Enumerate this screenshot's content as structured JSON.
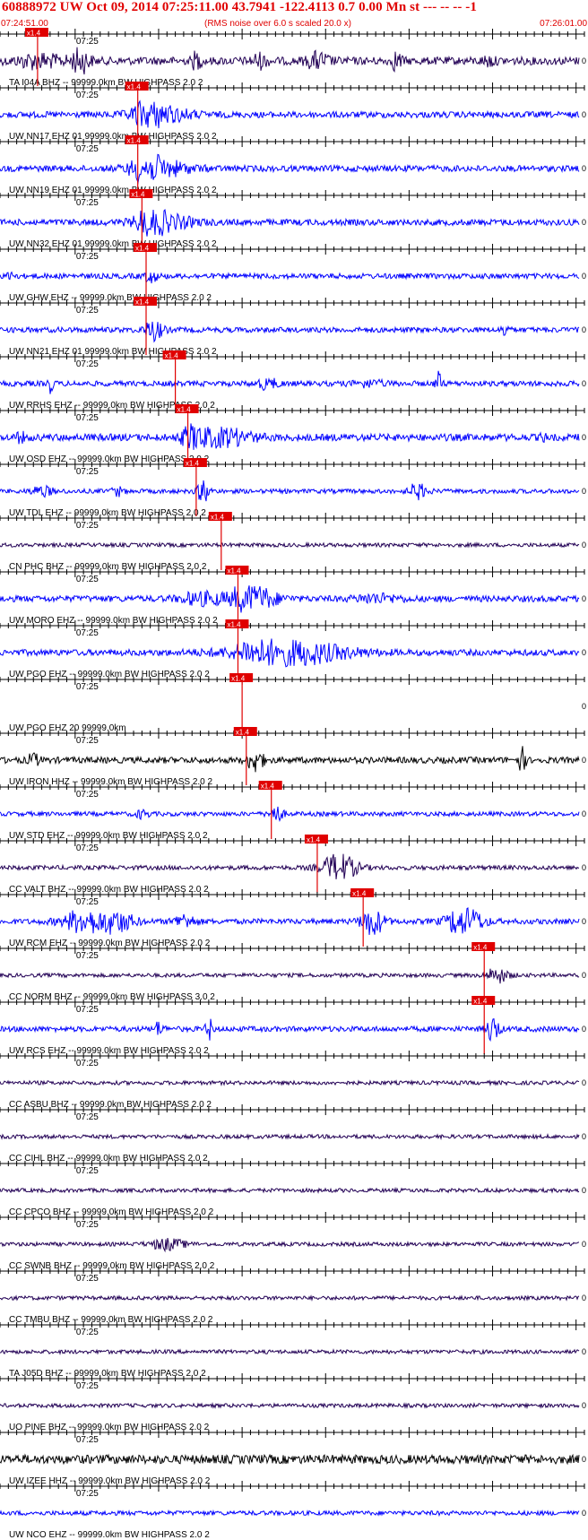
{
  "header": {
    "title": "60888972 UW Oct 09, 2014 07:25:11.00    43.7941 -122.4113  0.7 0.00 Mn st --- -- --  -1",
    "start_time": "07:24:51.00",
    "noise_note": "(RMS noise over 6.0 s scaled 20.0 x)",
    "end_time": "07:26:01.00"
  },
  "colors": {
    "red": "#e00000",
    "blue": "#0000ff",
    "navy": "#220055",
    "black": "#000000",
    "axis": "#000000"
  },
  "chart_data": {
    "type": "seismogram",
    "x_range_seconds": [
      0,
      70
    ],
    "x_start": "07:24:51.00",
    "x_end": "07:26:01.00",
    "minute_tick_label": "07:25",
    "minute_tick_seconds": 9,
    "pick_label": "x1.4",
    "traces": [
      {
        "label": "TA I04A BHZ -- 99999.0km BW  HIGHPASS  2.0  2",
        "color": "navy",
        "amp": 0.45,
        "pick_seconds": 4.5,
        "bursts": [
          [
            9.5,
            0.8,
            1.4
          ],
          [
            4.5,
            2.0,
            0.7
          ],
          [
            23.5,
            0.4,
            0.9
          ],
          [
            31,
            0.7,
            0.7
          ],
          [
            38,
            1.0,
            0.8
          ],
          [
            47.5,
            0.4,
            1.0
          ],
          [
            58.5,
            0.5,
            0.5
          ]
        ]
      },
      {
        "label": "UW NN17 EHZ 01 99999.0km BW  HIGHPASS  2.0  2",
        "color": "blue",
        "amp": 0.35,
        "pick_seconds": 16.5,
        "bursts": [
          [
            17.5,
            1.0,
            2.2
          ],
          [
            19,
            2.5,
            0.9
          ]
        ]
      },
      {
        "label": "UW NN19 EHZ 01 99999.0km BW  HIGHPASS  2.0  2",
        "color": "blue",
        "amp": 0.35,
        "pick_seconds": 16.5,
        "bursts": [
          [
            17.2,
            1.0,
            2.2
          ],
          [
            19,
            2.5,
            0.9
          ]
        ]
      },
      {
        "label": "UW NN32 EHZ 01 99999.0km BW  HIGHPASS  2.0  2",
        "color": "blue",
        "amp": 0.35,
        "pick_seconds": 17,
        "bursts": [
          [
            17.8,
            1.0,
            1.8
          ],
          [
            19.5,
            2.5,
            0.8
          ]
        ]
      },
      {
        "label": "UW GHW EHZ -- 99999.0km BW  HIGHPASS  2.0  2",
        "color": "blue",
        "amp": 0.3,
        "pick_seconds": 17.5,
        "bursts": [
          [
            1.3,
            0.3,
            0.7
          ],
          [
            18,
            0.6,
            0.6
          ]
        ]
      },
      {
        "label": "UW NN21 EHZ 01 99999.0km BW  HIGHPASS  2.0  2",
        "color": "blue",
        "amp": 0.3,
        "pick_seconds": 17.5,
        "bursts": [
          [
            18.3,
            0.8,
            1.1
          ],
          [
            60.5,
            0.3,
            0.8
          ]
        ]
      },
      {
        "label": "UW RRHS EHZ -- 99999.0km BW  HIGHPASS  2.0  2",
        "color": "blue",
        "amp": 0.3,
        "pick_seconds": 21,
        "bursts": [
          [
            6,
            0.3,
            0.9
          ],
          [
            32,
            1.0,
            0.5
          ],
          [
            44,
            1.5,
            0.3
          ],
          [
            52.5,
            0.3,
            1.2
          ]
        ]
      },
      {
        "label": "UW OSD EHZ -- 99999.0km BW  HIGHPASS  2.0  2",
        "color": "blue",
        "amp": 0.4,
        "pick_seconds": 22.5,
        "bursts": [
          [
            23,
            0.8,
            2.0
          ],
          [
            26.5,
            2.5,
            0.9
          ],
          [
            2.5,
            0.5,
            0.4
          ],
          [
            65,
            0.2,
            0.6
          ]
        ]
      },
      {
        "label": "UW TDL EHZ -- 99999.0km BW  HIGHPASS  2.0  2",
        "color": "blue",
        "amp": 0.25,
        "pick_seconds": 23.5,
        "bursts": [
          [
            24.3,
            0.5,
            1.3
          ],
          [
            5,
            1.0,
            0.5
          ],
          [
            14,
            0.5,
            0.5
          ],
          [
            50,
            0.8,
            0.8
          ]
        ]
      },
      {
        "label": "CN PHC BHZ -- 99999.0km BW  HIGHPASS  2.0  2",
        "color": "navy",
        "amp": 0.22,
        "pick_seconds": 26.5,
        "bursts": []
      },
      {
        "label": "UW MORO EHZ -- 99999.0km BW  HIGHPASS  2.0  2",
        "color": "blue",
        "amp": 0.35,
        "pick_seconds": 28.5,
        "bursts": [
          [
            30,
            2.0,
            1.5
          ],
          [
            24,
            2.0,
            0.6
          ],
          [
            45,
            2.0,
            0.4
          ]
        ]
      },
      {
        "label": "UW PGO EHZ -- 99999.0km BW  HIGHPASS  2.0  2",
        "color": "blue",
        "amp": 0.35,
        "pick_seconds": 28.5,
        "bursts": [
          [
            34,
            5.0,
            1.4
          ],
          [
            30,
            1.0,
            1.0
          ]
        ]
      },
      {
        "label": "UW PGO EHZ 20 99999.0km",
        "color": "none",
        "amp": 0,
        "pick_seconds": 29,
        "bursts": []
      },
      {
        "label": "UW IRON HHZ -- 99999.0km BW  HIGHPASS  2.0  2",
        "color": "black",
        "amp": 0.35,
        "pick_seconds": 29.5,
        "bursts": [
          [
            30.5,
            0.7,
            1.2
          ],
          [
            4,
            0.5,
            0.6
          ],
          [
            62.5,
            0.3,
            1.5
          ]
        ]
      },
      {
        "label": "UW STD EHZ -- 99999.0km BW  HIGHPASS  2.0  2",
        "color": "blue",
        "amp": 0.25,
        "pick_seconds": 32.5,
        "bursts": [
          [
            33,
            0.6,
            0.9
          ],
          [
            17,
            0.6,
            0.4
          ]
        ]
      },
      {
        "label": "CC VALT BHZ -- 99999.0km BW  HIGHPASS  2.0  2",
        "color": "navy",
        "amp": 0.25,
        "pick_seconds": 38,
        "bursts": [
          [
            40.5,
            1.5,
            1.6
          ]
        ]
      },
      {
        "label": "UW RCM EHZ -- 99999.0km BW  HIGHPASS  2.0  2",
        "color": "blue",
        "amp": 0.3,
        "pick_seconds": 43.5,
        "bursts": [
          [
            10,
            2.0,
            1.2
          ],
          [
            14,
            1.5,
            1.0
          ],
          [
            22,
            1.0,
            0.7
          ],
          [
            44.5,
            1.0,
            1.6
          ],
          [
            55.5,
            1.5,
            1.8
          ]
        ]
      },
      {
        "label": "CC NORM BHZ -- 99999.0km BW  HIGHPASS  3.0  2",
        "color": "navy",
        "amp": 0.22,
        "pick_seconds": 58,
        "bursts": [
          [
            59.5,
            1.0,
            0.8
          ]
        ]
      },
      {
        "label": "UW RCS EHZ -- 99999.0km BW  HIGHPASS  2.0  2",
        "color": "blue",
        "amp": 0.3,
        "pick_seconds": 58,
        "bursts": [
          [
            59,
            0.5,
            1.8
          ],
          [
            25,
            0.3,
            1.2
          ],
          [
            19,
            0.4,
            0.7
          ]
        ]
      },
      {
        "label": "CC ASBU BHZ -- 99999.0km BW  HIGHPASS  2.0  2",
        "color": "navy",
        "amp": 0.22,
        "pick_seconds": null,
        "bursts": []
      },
      {
        "label": "CC CIHL BHZ -- 99999.0km BW  HIGHPASS  2.0  2",
        "color": "navy",
        "amp": 0.22,
        "pick_seconds": null,
        "bursts": []
      },
      {
        "label": "CC CPCO BHZ -- 99999.0km BW  HIGHPASS  2.0  2",
        "color": "navy",
        "amp": 0.22,
        "pick_seconds": null,
        "bursts": []
      },
      {
        "label": "CC SWNB BHZ -- 99999.0km BW  HIGHPASS  2.0  2",
        "color": "navy",
        "amp": 0.22,
        "pick_seconds": null,
        "bursts": [
          [
            20,
            1.5,
            0.6
          ]
        ]
      },
      {
        "label": "CC TMBU BHZ -- 99999.0km BW  HIGHPASS  2.0  2",
        "color": "navy",
        "amp": 0.22,
        "pick_seconds": null,
        "bursts": []
      },
      {
        "label": "TA J05D BHZ -- 99999.0km BW  HIGHPASS  2.0  2",
        "color": "navy",
        "amp": 0.22,
        "pick_seconds": null,
        "bursts": []
      },
      {
        "label": "UO PINE BHZ -- 99999.0km BW  HIGHPASS  2.0  2",
        "color": "navy",
        "amp": 0.22,
        "pick_seconds": null,
        "bursts": []
      },
      {
        "label": "UW IZEE HHZ -- 99999.0km BW  HIGHPASS  2.0  2",
        "color": "black",
        "amp": 0.5,
        "pick_seconds": null,
        "bursts": []
      },
      {
        "label": "UW NCO EHZ -- 99999.0km BW  HIGHPASS  2.0  2",
        "color": "blue",
        "amp": 0.25,
        "pick_seconds": null,
        "bursts": []
      }
    ]
  }
}
